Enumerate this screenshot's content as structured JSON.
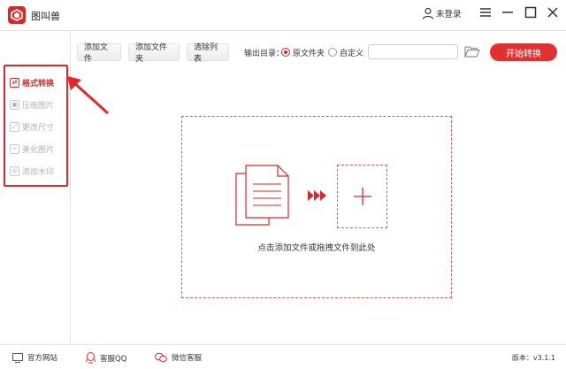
{
  "app": {
    "title": "图叫兽"
  },
  "user": {
    "login_label": "未登录"
  },
  "sidebar": {
    "items": [
      {
        "label": "格式转换",
        "icon": "convert-icon",
        "active": true
      },
      {
        "label": "压缩图片",
        "icon": "compress-icon",
        "active": false
      },
      {
        "label": "更改尺寸",
        "icon": "resize-icon",
        "active": false
      },
      {
        "label": "美化图片",
        "icon": "beautify-icon",
        "active": false
      },
      {
        "label": "添加水印",
        "icon": "watermark-icon",
        "active": false
      }
    ]
  },
  "toolbar": {
    "add_file": "添加文件",
    "add_folder": "添加文件夹",
    "clear_list": "清除列表",
    "output_label": "输出目录：",
    "radio_original": "原文件夹",
    "radio_custom": "自定义",
    "output_path_value": "",
    "start_button": "开始转换"
  },
  "dropzone": {
    "hint": "点击添加文件或拖拽文件到此处"
  },
  "statusbar": {
    "website": "官方网站",
    "qq": "客服QQ",
    "wechat": "微信客服",
    "version": "版本：v3.1.1"
  },
  "colors": {
    "accent": "#e3302f",
    "annotation": "#e4262a",
    "dashed": "#d85a5a"
  }
}
